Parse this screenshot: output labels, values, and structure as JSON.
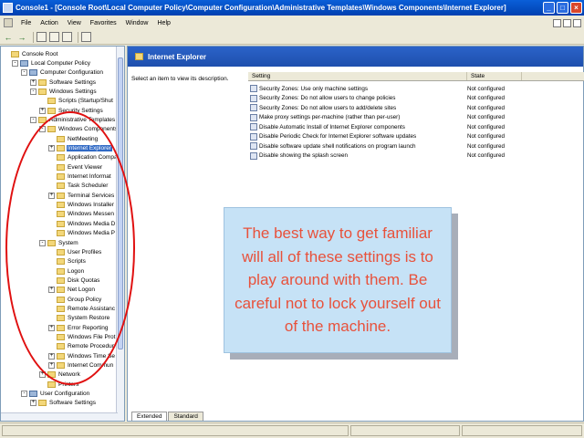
{
  "window": {
    "title": "Console1 - [Console Root\\Local Computer Policy\\Computer Configuration\\Administrative Templates\\Windows Components\\Internet Explorer]",
    "minimize": "_",
    "maximize": "□",
    "close": "×"
  },
  "menu": {
    "items": [
      "File",
      "Action",
      "View",
      "Favorites",
      "Window",
      "Help"
    ]
  },
  "toolbar": {
    "back": "←",
    "forward": "→"
  },
  "tree": {
    "nodes": [
      {
        "label": "Console Root",
        "level": 0,
        "exp": "",
        "type": "folder"
      },
      {
        "label": "Local Computer Policy",
        "level": 1,
        "exp": "-",
        "type": "comp"
      },
      {
        "label": "Computer Configuration",
        "level": 2,
        "exp": "-",
        "type": "comp"
      },
      {
        "label": "Software Settings",
        "level": 3,
        "exp": "+",
        "type": "folder"
      },
      {
        "label": "Windows Settings",
        "level": 3,
        "exp": "-",
        "type": "folder"
      },
      {
        "label": "Scripts (Startup/Shut",
        "level": 4,
        "exp": "",
        "type": "doc"
      },
      {
        "label": "Security Settings",
        "level": 4,
        "exp": "+",
        "type": "folder"
      },
      {
        "label": "Administrative Templates",
        "level": 3,
        "exp": "-",
        "type": "folder"
      },
      {
        "label": "Windows Components",
        "level": 4,
        "exp": "-",
        "type": "folder"
      },
      {
        "label": "NetMeeting",
        "level": 5,
        "exp": "",
        "type": "folder"
      },
      {
        "label": "Internet Explorer",
        "level": 5,
        "exp": "+",
        "type": "folder",
        "selected": true
      },
      {
        "label": "Application Compa",
        "level": 5,
        "exp": "",
        "type": "folder"
      },
      {
        "label": "Event Viewer",
        "level": 5,
        "exp": "",
        "type": "folder"
      },
      {
        "label": "Internet Informat",
        "level": 5,
        "exp": "",
        "type": "folder"
      },
      {
        "label": "Task Scheduler",
        "level": 5,
        "exp": "",
        "type": "folder"
      },
      {
        "label": "Terminal Services",
        "level": 5,
        "exp": "+",
        "type": "folder"
      },
      {
        "label": "Windows Installer",
        "level": 5,
        "exp": "",
        "type": "folder"
      },
      {
        "label": "Windows Messen",
        "level": 5,
        "exp": "",
        "type": "folder"
      },
      {
        "label": "Windows Media D",
        "level": 5,
        "exp": "",
        "type": "folder"
      },
      {
        "label": "Windows Media P",
        "level": 5,
        "exp": "",
        "type": "folder"
      },
      {
        "label": "System",
        "level": 4,
        "exp": "-",
        "type": "folder"
      },
      {
        "label": "User Profiles",
        "level": 5,
        "exp": "",
        "type": "folder"
      },
      {
        "label": "Scripts",
        "level": 5,
        "exp": "",
        "type": "folder"
      },
      {
        "label": "Logon",
        "level": 5,
        "exp": "",
        "type": "folder"
      },
      {
        "label": "Disk Quotas",
        "level": 5,
        "exp": "",
        "type": "folder"
      },
      {
        "label": "Net Logon",
        "level": 5,
        "exp": "+",
        "type": "folder"
      },
      {
        "label": "Group Policy",
        "level": 5,
        "exp": "",
        "type": "folder"
      },
      {
        "label": "Remote Assistanc",
        "level": 5,
        "exp": "",
        "type": "folder"
      },
      {
        "label": "System Restore",
        "level": 5,
        "exp": "",
        "type": "folder"
      },
      {
        "label": "Error Reporting",
        "level": 5,
        "exp": "+",
        "type": "folder"
      },
      {
        "label": "Windows File Prot",
        "level": 5,
        "exp": "",
        "type": "folder"
      },
      {
        "label": "Remote Procedur",
        "level": 5,
        "exp": "",
        "type": "folder"
      },
      {
        "label": "Windows Time Se",
        "level": 5,
        "exp": "+",
        "type": "folder"
      },
      {
        "label": "Internet Commun",
        "level": 5,
        "exp": "+",
        "type": "folder"
      },
      {
        "label": "Network",
        "level": 4,
        "exp": "+",
        "type": "folder"
      },
      {
        "label": "Printers",
        "level": 4,
        "exp": "",
        "type": "folder"
      },
      {
        "label": "User Configuration",
        "level": 2,
        "exp": "-",
        "type": "comp"
      },
      {
        "label": "Software Settings",
        "level": 3,
        "exp": "+",
        "type": "folder"
      }
    ]
  },
  "right": {
    "header": "Internet Explorer",
    "description": "Select an item to view its description.",
    "columns": {
      "setting": "Setting",
      "state": "State"
    },
    "rows": [
      {
        "name": "Security Zones: Use only machine settings",
        "state": "Not configured"
      },
      {
        "name": "Security Zones: Do not allow users to change policies",
        "state": "Not configured"
      },
      {
        "name": "Security Zones: Do not allow users to add/delete sites",
        "state": "Not configured"
      },
      {
        "name": "Make proxy settings per-machine (rather than per-user)",
        "state": "Not configured"
      },
      {
        "name": "Disable Automatic Install of Internet Explorer components",
        "state": "Not configured"
      },
      {
        "name": "Disable Periodic Check for Internet Explorer software updates",
        "state": "Not configured"
      },
      {
        "name": "Disable software update shell notifications on program launch",
        "state": "Not configured"
      },
      {
        "name": "Disable showing the splash screen",
        "state": "Not configured"
      }
    ],
    "tabs": [
      "Extended",
      "Standard"
    ]
  },
  "callout": {
    "text": "The best way to get familiar will all of these settings is to play around with them. Be careful not to lock yourself out of the machine."
  },
  "colors": {
    "annotation_red": "#e01010",
    "callout_bg": "#c6e2f6",
    "callout_text": "#e8513b",
    "selection": "#316ac5"
  }
}
